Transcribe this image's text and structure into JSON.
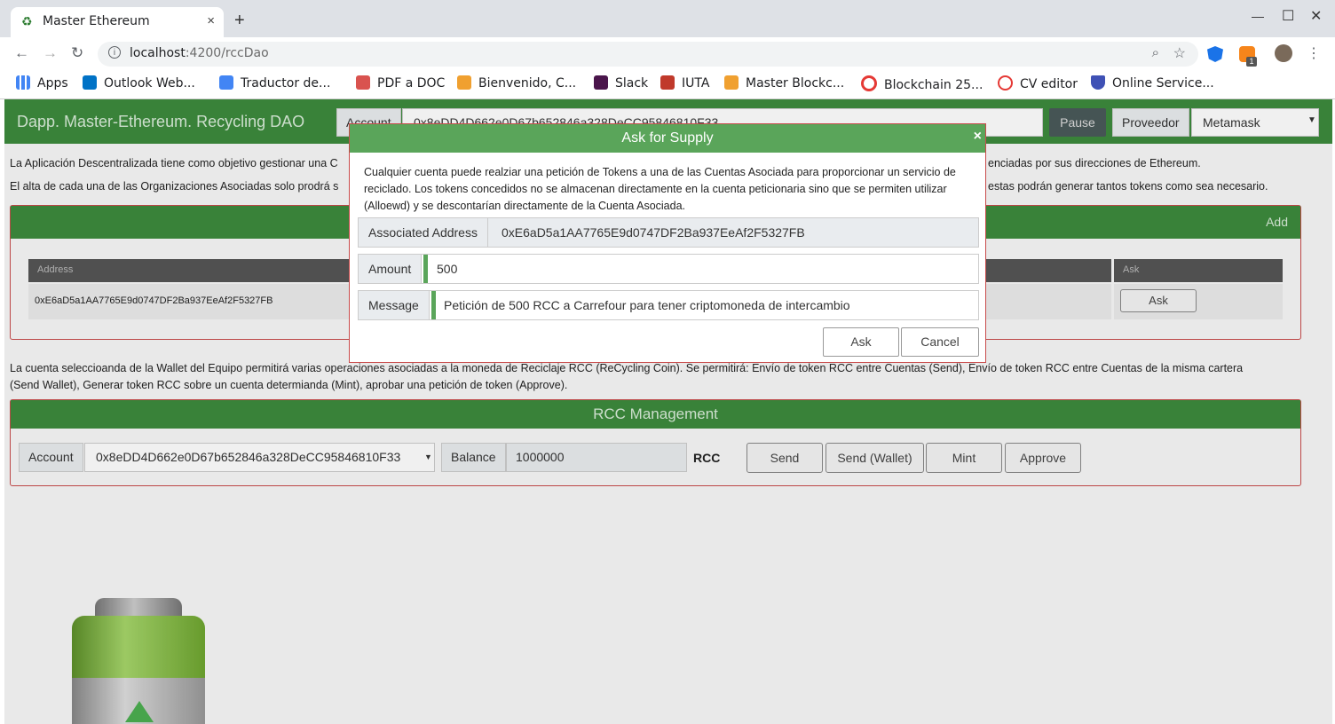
{
  "browser": {
    "tab_title": "Master Ethereum",
    "tab_close": "×",
    "new_tab": "+",
    "url_host": "localhost",
    "url_path": ":4200/rccDao",
    "extension_badge": "1",
    "bookmarks": [
      {
        "label": "Apps",
        "color": "#4285f4"
      },
      {
        "label": "Outlook Web...",
        "color": "#0072c6"
      },
      {
        "label": "Traductor de...",
        "color": "#4285f4"
      },
      {
        "label": "PDF a DOC",
        "color": "#d9534f"
      },
      {
        "label": "Bienvenido, C...",
        "color": "#f0a030"
      },
      {
        "label": "Slack",
        "color": "#4a154b"
      },
      {
        "label": "IUTA",
        "color": "#c0392b"
      },
      {
        "label": "Master Blockc...",
        "color": "#f0a030"
      },
      {
        "label": "Blockchain 25...",
        "color": "#e53935"
      },
      {
        "label": "CV editor",
        "color": "#e53935"
      },
      {
        "label": "Online Service...",
        "color": "#3f51b5"
      }
    ]
  },
  "app": {
    "brand": "Dapp. Master-Ethereum. Recycling DAO",
    "account_label": "Account",
    "account_value": "0x8eDD4D662e0D67b652846a328DeCC95846810F33",
    "pause_button": "Pause",
    "provider_label": "Proveedor",
    "provider_value": "Metamask",
    "intro_1_left": "La Aplicación Descentralizada tiene como objetivo gestionar una C",
    "intro_1_right": "enciadas por sus direcciones de Ethereum.",
    "intro_2_left": "El alta de cada una de las Organizaciones Asociadas solo prodrá s",
    "intro_2_right": "estas podrán generar tantos tokens como sea necesario.",
    "assoc_panel": {
      "add_link": "Add",
      "col_address": "Address",
      "col_ask": "Ask",
      "row_address": "0xE6aD5a1AA7765E9d0747DF2Ba937EeAf2F5327FB",
      "ask_button": "Ask"
    },
    "wallet_text_1": "La cuenta seleccioanda de la Wallet del Equipo permitirá varias operaciones asociadas a la moneda de Reciclaje RCC (ReCycling Coin). Se permitirá: Envío de token RCC entre Cuentas (Send), Envío de token RCC entre Cuentas de la misma cartera",
    "wallet_text_2": "(Send Wallet), Generar token RCC sobre un cuenta determianda (Mint), aprobar una petición de token (Approve).",
    "rcc": {
      "title": "RCC Management",
      "account_label": "Account",
      "account_value": "0x8eDD4D662e0D67b652846a328DeCC95846810F33",
      "balance_label": "Balance",
      "balance_value": "1000000",
      "unit": "RCC",
      "send": "Send",
      "send_wallet": "Send (Wallet)",
      "mint": "Mint",
      "approve": "Approve"
    }
  },
  "modal": {
    "title": "Ask for Supply",
    "close": "×",
    "description": "Cualquier cuenta puede realziar una petición de Tokens a una de las Cuentas Asociada para proporcionar un servicio de reciclado. Los tokens concedidos no se almacenan directamente en la cuenta peticionaria sino que se permiten utilizar (Alloewd) y se descontarían directamente de la Cuenta Asociada.",
    "associated_label": "Associated Address",
    "associated_value": "0xE6aD5a1AA7765E9d0747DF2Ba937EeAf2F5327FB",
    "amount_label": "Amount",
    "amount_value": "500",
    "message_label": "Message",
    "message_value": "Petición de 500 RCC a Carrefour para tener criptomoneda de intercambio",
    "ask_button": "Ask",
    "cancel_button": "Cancel"
  },
  "colors": {
    "header_green": "#3d8b3d",
    "modal_green": "#5aa55a",
    "panel_border": "#c94b4b"
  }
}
